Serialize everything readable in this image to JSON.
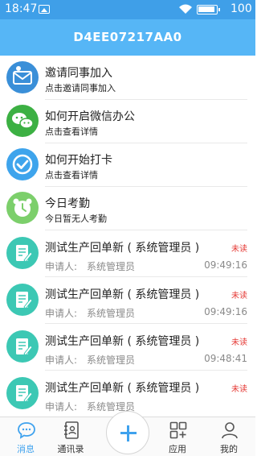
{
  "status_bar": {
    "time": "18:47",
    "battery": "100"
  },
  "header": {
    "title": "D4EE07217AA0"
  },
  "app_items": [
    {
      "title": "邀请同事加入",
      "subtitle": "点击邀请同事加入",
      "icon": "invite-envelope-icon",
      "color": "#3a8fd8"
    },
    {
      "title": "如何开启微信办公",
      "subtitle": "点击查看详情",
      "icon": "wechat-icon",
      "color": "#3cb043"
    },
    {
      "title": "如何开始打卡",
      "subtitle": "点击查看详情",
      "icon": "checkmark-icon",
      "color": "#3ea4ec"
    },
    {
      "title": "今日考勤",
      "subtitle": "今日暂无人考勤",
      "icon": "alarm-clock-icon",
      "color": "#7ccf6b"
    }
  ],
  "documents": [
    {
      "title": "测试生产回单新 ( 系统管理员 )",
      "status": "未读",
      "applicant_label": "申请人:",
      "applicant": "系统管理员",
      "time": "09:49:16"
    },
    {
      "title": "测试生产回单新 ( 系统管理员 )",
      "status": "未读",
      "applicant_label": "申请人:",
      "applicant": "系统管理员",
      "time": "09:49:16"
    },
    {
      "title": "测试生产回单新 ( 系统管理员 )",
      "status": "未读",
      "applicant_label": "申请人:",
      "applicant": "系统管理员",
      "time": "09:48:41"
    },
    {
      "title": "测试生产回单新 ( 系统管理员 )",
      "status": "未读",
      "applicant_label": "申请人:",
      "applicant": "系统管理员",
      "time": ""
    }
  ],
  "doc_icon_color": "#3cc8b4",
  "tabs": [
    {
      "label": "消息",
      "icon": "chat-bubble-icon",
      "active": true
    },
    {
      "label": "通讯录",
      "icon": "contacts-book-icon",
      "active": false
    },
    {
      "label": "",
      "icon": "plus-icon",
      "active": false
    },
    {
      "label": "应用",
      "icon": "apps-grid-icon",
      "active": false
    },
    {
      "label": "我的",
      "icon": "person-icon",
      "active": false
    }
  ],
  "accent_color": "#56b6f6"
}
